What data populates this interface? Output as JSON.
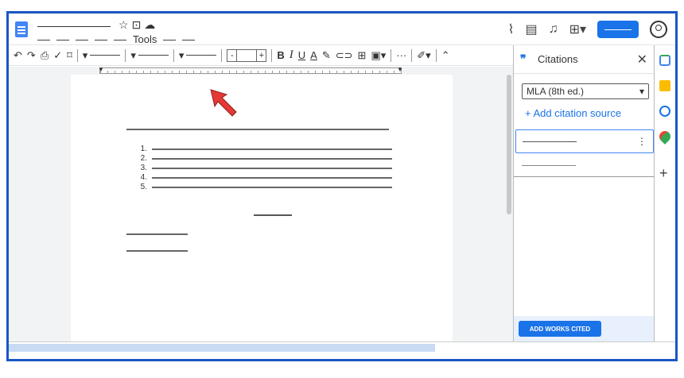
{
  "titlebar": {
    "menu_tools_label": "Tools",
    "icons": [
      "star-icon",
      "move-to-folder-icon",
      "cloud-status-icon"
    ],
    "right_icons": [
      "activity-trend-icon",
      "comments-icon",
      "notifications-bell-icon",
      "meet-present-icon",
      "account-circle-icon"
    ]
  },
  "toolbar": {
    "icons": [
      "undo-icon",
      "redo-icon",
      "print-icon",
      "spellcheck-icon",
      "paint-format-icon"
    ],
    "font_size_minus": "-",
    "font_size_plus": "+",
    "bold_label": "B",
    "italic_label": "I",
    "underline_label": "U",
    "text_color_label": "A",
    "more_label": "···",
    "format_icons": [
      "highlight-pen-icon",
      "link-icon",
      "add-comment-icon",
      "insert-image-icon",
      "edit-mode-pencil-icon",
      "collapse-chevron-up-icon"
    ]
  },
  "document": {
    "list_numbers": [
      "1.",
      "2.",
      "3.",
      "4.",
      "5."
    ]
  },
  "citations_panel": {
    "title": "Citations",
    "close_symbol": "✕",
    "style_selected": "MLA (8th ed.)",
    "add_source_label": "+ Add citation source",
    "more_options_symbol": "⋮",
    "insert_button_label": "ADD WORKS CITED"
  },
  "side_rail": {
    "icons": [
      "google-calendar-icon",
      "google-keep-icon",
      "google-tasks-icon",
      "google-maps-icon",
      "add-app-plus-icon"
    ]
  },
  "colors": {
    "frame_border": "#1a56c4",
    "accent_blue": "#1a73e8",
    "annotation_arrow": "#e53935"
  }
}
